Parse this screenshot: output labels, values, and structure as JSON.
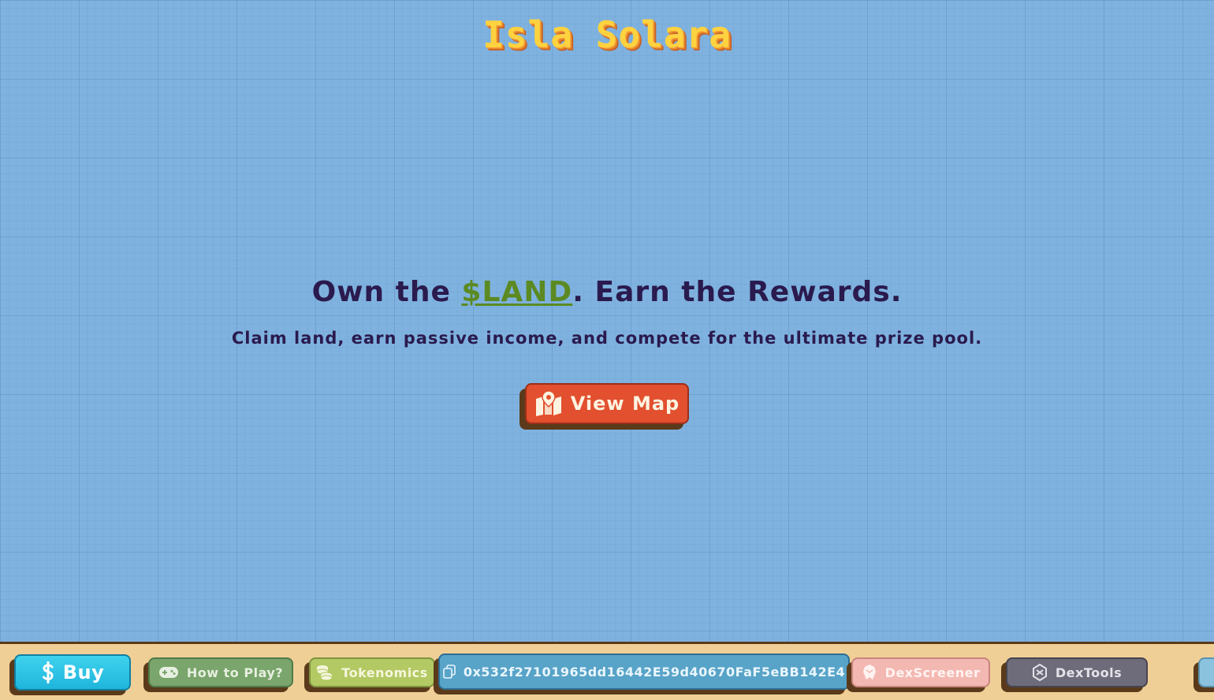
{
  "header": {
    "logo_text": "Isla Solara"
  },
  "hero": {
    "title_prefix": "Own the ",
    "title_token": "$LAND",
    "title_suffix": ". Earn the Rewards.",
    "subtitle": "Claim land, earn passive income, and compete for the ultimate prize pool.",
    "cta_label": "View Map",
    "cta_icon": "map-pin-icon"
  },
  "bottom_bar": {
    "items": [
      {
        "label": "Buy",
        "icon": "dollar-icon",
        "color": "#1fb5dc"
      },
      {
        "label": "How to Play?",
        "icon": "gamepad-icon",
        "color": "#7aa56c"
      },
      {
        "label": "Tokenomics",
        "icon": "coins-icon",
        "color": "#b3c963"
      },
      {
        "label": "0x532f27101965dd16442E59d40670FaF5eBB142E4",
        "icon": "copy-icon",
        "color": "#58a3c8"
      },
      {
        "label": "DexScreener",
        "icon": "dexscreener-icon",
        "color": "#f4b8b2"
      },
      {
        "label": "DexTools",
        "icon": "dextools-icon",
        "color": "#6e6c7a"
      },
      {
        "label": "",
        "icon": "telegram-icon",
        "color": "#8bc3df"
      }
    ]
  },
  "colors": {
    "background": "#7fb2df",
    "title_text": "#2a1a4e",
    "token_accent": "#5c8a22",
    "cta_background": "#e2502f",
    "bar_background": "#f0cf97"
  }
}
